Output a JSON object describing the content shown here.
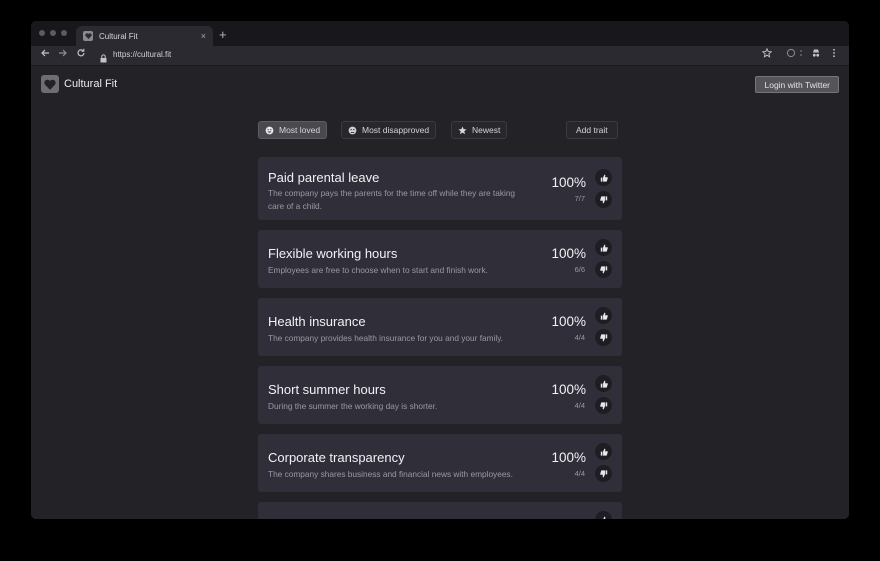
{
  "browser": {
    "tab_title": "Cultural Fit",
    "new_tab": "+",
    "tab_close": "×",
    "url": "https://cultural.fit"
  },
  "header": {
    "brand": "Cultural Fit",
    "login_label": "Login with Twitter"
  },
  "filters": {
    "most_loved": "Most loved",
    "most_disapproved": "Most disapproved",
    "newest": "Newest",
    "add_trait": "Add trait"
  },
  "traits": [
    {
      "title": "Paid parental leave",
      "desc": "The company pays the parents for the time off while they are taking care of a child.",
      "pct": "100%",
      "votes": "7/7"
    },
    {
      "title": "Flexible working hours",
      "desc": "Employees are free to choose when to start and finish work.",
      "pct": "100%",
      "votes": "6/6"
    },
    {
      "title": "Health insurance",
      "desc": "The company provides health insurance for you and your family.",
      "pct": "100%",
      "votes": "4/4"
    },
    {
      "title": "Short summer hours",
      "desc": "During the summer the working day is shorter.",
      "pct": "100%",
      "votes": "4/4"
    },
    {
      "title": "Corporate transparency",
      "desc": "The company shares business and financial news with employees.",
      "pct": "100%",
      "votes": "4/4"
    }
  ],
  "colors": {
    "background": "#232227",
    "card": "#302f39",
    "text": "#f2f1f5",
    "muted": "#9a98a3"
  }
}
